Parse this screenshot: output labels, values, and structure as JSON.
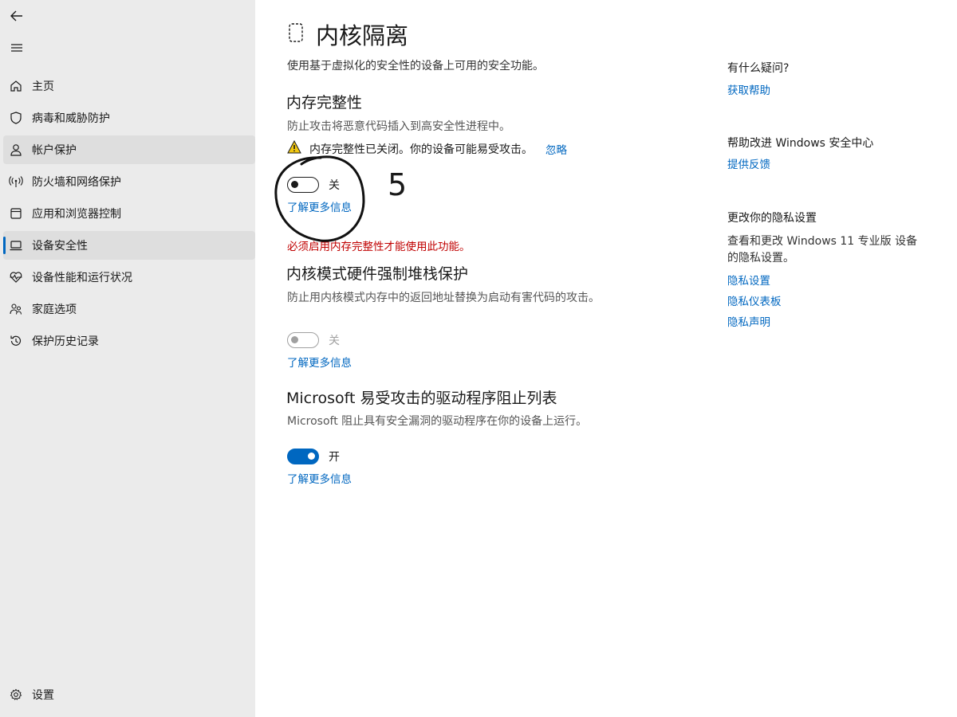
{
  "sidebar": {
    "items": [
      {
        "label": "主页",
        "icon": "home-icon"
      },
      {
        "label": "病毒和威胁防护",
        "icon": "shield-icon"
      },
      {
        "label": "帐户保护",
        "icon": "person-icon"
      },
      {
        "label": "防火墙和网络保护",
        "icon": "antenna-icon"
      },
      {
        "label": "应用和浏览器控制",
        "icon": "app-window-icon"
      },
      {
        "label": "设备安全性",
        "icon": "laptop-icon"
      },
      {
        "label": "设备性能和运行状况",
        "icon": "heart-pulse-icon"
      },
      {
        "label": "家庭选项",
        "icon": "family-icon"
      },
      {
        "label": "保护历史记录",
        "icon": "history-icon"
      }
    ],
    "settings_label": "设置"
  },
  "page": {
    "title": "内核隔离",
    "description": "使用基于虚拟化的安全性的设备上可用的安全功能。"
  },
  "memory_integrity": {
    "title": "内存完整性",
    "description": "防止攻击将恶意代码插入到高安全性进程中。",
    "warning": "内存完整性已关闭。你的设备可能易受攻击。",
    "ignore_link": "忽略",
    "toggle_state": "关",
    "learn_more": "了解更多信息"
  },
  "error_message": "必须启用内存完整性才能使用此功能。",
  "kernel_stack": {
    "title": "内核模式硬件强制堆栈保护",
    "description": "防止用内核模式内存中的返回地址替换为启动有害代码的攻击。",
    "toggle_state": "关",
    "learn_more": "了解更多信息"
  },
  "driver_blocklist": {
    "title": "Microsoft 易受攻击的驱动程序阻止列表",
    "description": "Microsoft 阻止具有安全漏洞的驱动程序在你的设备上运行。",
    "toggle_state": "开",
    "learn_more": "了解更多信息"
  },
  "right_panel": {
    "questions_heading": "有什么疑问?",
    "get_help": "获取帮助",
    "improve_heading": "帮助改进 Windows 安全中心",
    "give_feedback": "提供反馈",
    "privacy_heading": "更改你的隐私设置",
    "privacy_text": "查看和更改 Windows 11 专业版 设备的隐私设置。",
    "privacy_settings": "隐私设置",
    "privacy_dashboard": "隐私仪表板",
    "privacy_statement": "隐私声明"
  },
  "annotation": {
    "number": "5"
  },
  "colors": {
    "accent": "#0067c0",
    "error": "#c00000",
    "sidebar_bg": "#ebebeb"
  }
}
